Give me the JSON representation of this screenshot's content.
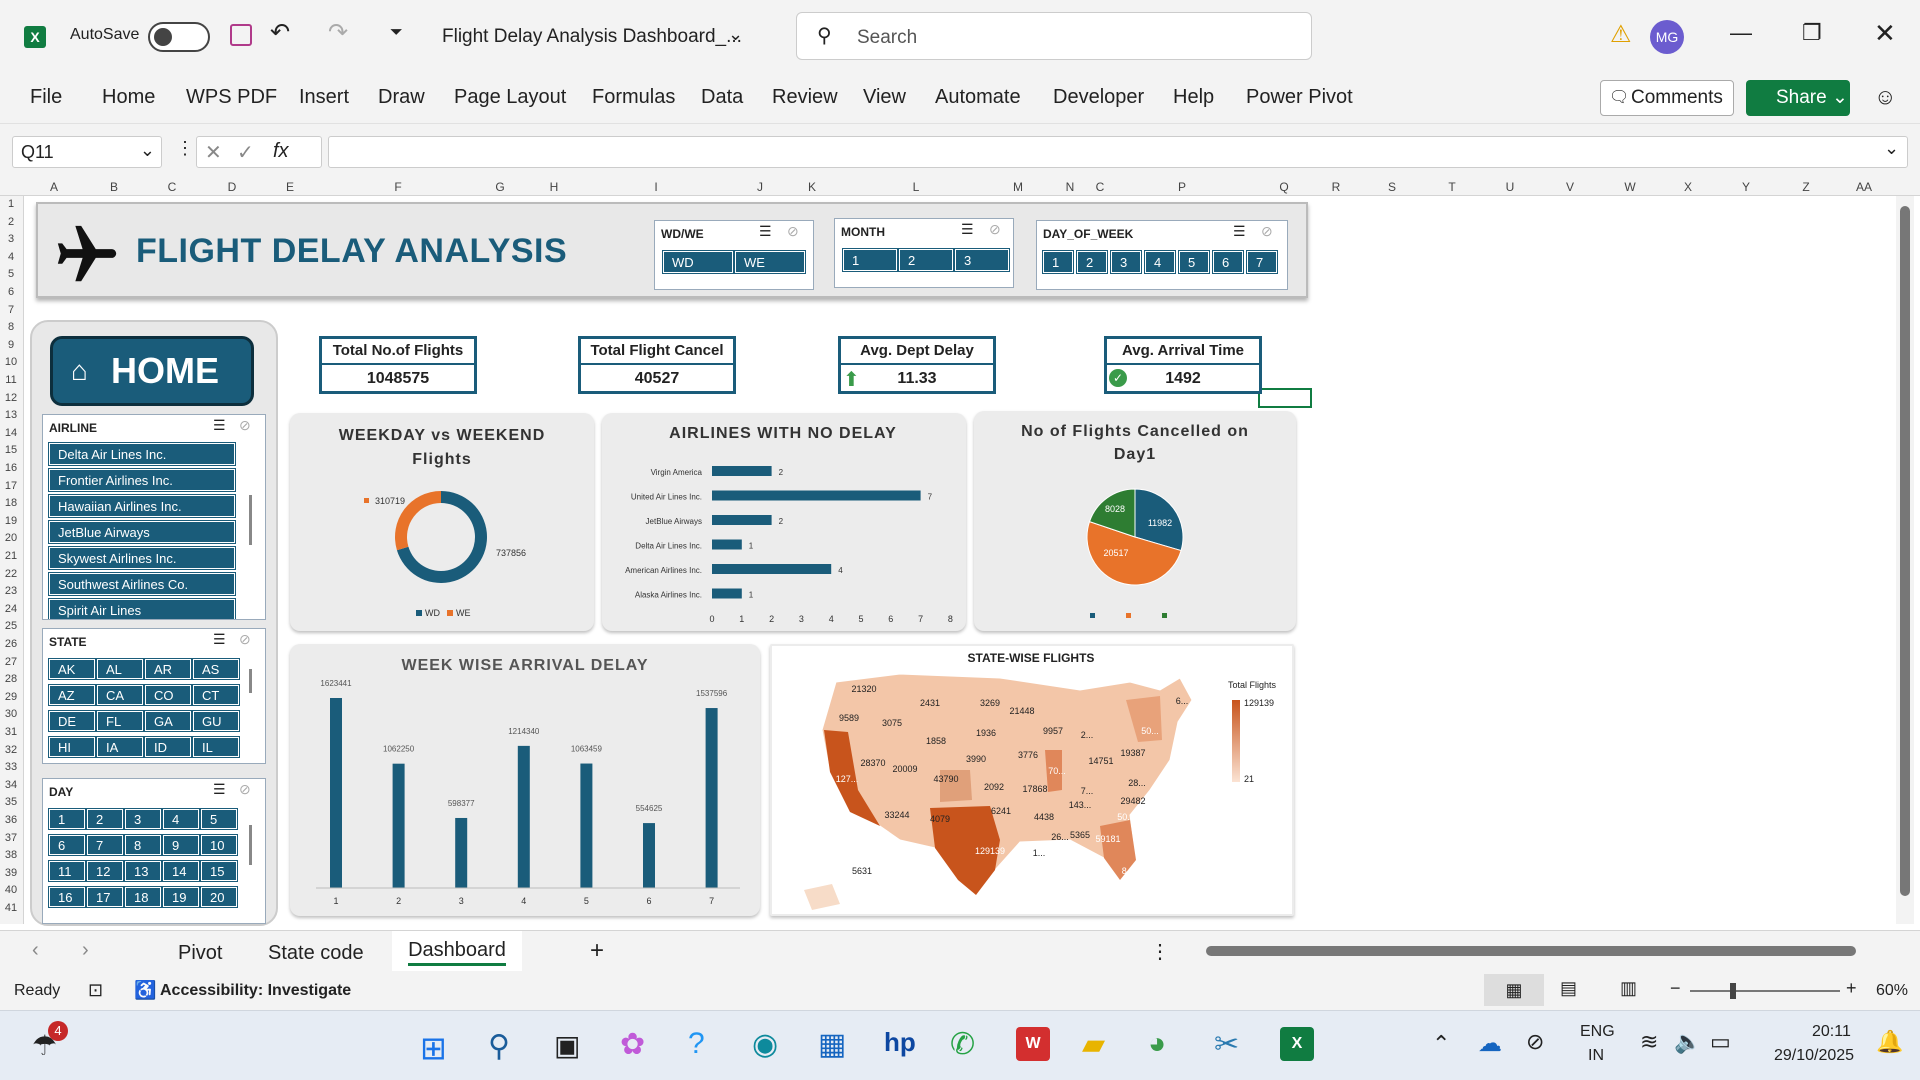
{
  "window": {
    "app_icon": "excel-icon",
    "autosave_label": "AutoSave",
    "autosave_state": "Off",
    "filename": "Flight Delay Analysis Dashboard_...",
    "search_placeholder": "Search",
    "user_initials": "MG"
  },
  "ribbon": {
    "tabs": [
      "File",
      "Home",
      "WPS PDF",
      "Insert",
      "Draw",
      "Page Layout",
      "Formulas",
      "Data",
      "Review",
      "View",
      "Automate",
      "Developer",
      "Help",
      "Power Pivot"
    ],
    "comments": "Comments",
    "share": "Share"
  },
  "formula": {
    "namebox": "Q11",
    "fx": "fx",
    "value": ""
  },
  "columns": [
    "A",
    "B",
    "C",
    "D",
    "E",
    "F",
    "G",
    "H",
    "I",
    "J",
    "K",
    "L",
    "M",
    "N",
    "C",
    "P",
    "Q",
    "R",
    "S",
    "T",
    "U",
    "V",
    "W",
    "X",
    "Y",
    "Z",
    "AA"
  ],
  "rows": [
    "1",
    "2",
    "3",
    "4",
    "5",
    "6",
    "7",
    "8",
    "9",
    "10",
    "11",
    "12",
    "13",
    "14",
    "15",
    "16",
    "17",
    "18",
    "19",
    "20",
    "21",
    "22",
    "23",
    "24",
    "25",
    "26",
    "27",
    "28",
    "29",
    "30",
    "31",
    "32",
    "33",
    "34",
    "35",
    "36",
    "37",
    "38",
    "39",
    "40",
    "41"
  ],
  "dashboard": {
    "title": "FLIGHT DELAY ANALYSIS",
    "home": "HOME",
    "slicers": {
      "wdwe": {
        "title": "WD/WE",
        "items": [
          "WD",
          "WE"
        ]
      },
      "month": {
        "title": "MONTH",
        "items": [
          "1",
          "2",
          "3"
        ]
      },
      "dow": {
        "title": "DAY_OF_WEEK",
        "items": [
          "1",
          "2",
          "3",
          "4",
          "5",
          "6",
          "7"
        ]
      },
      "airline": {
        "title": "AIRLINE",
        "items": [
          "Delta Air Lines Inc.",
          "Frontier Airlines Inc.",
          "Hawaiian Airlines Inc.",
          "JetBlue Airways",
          "Skywest Airlines Inc.",
          "Southwest Airlines Co.",
          "Spirit Air Lines"
        ]
      },
      "state": {
        "title": "STATE",
        "items": [
          "AK",
          "AL",
          "AR",
          "AS",
          "AZ",
          "CA",
          "CO",
          "CT",
          "DE",
          "FL",
          "GA",
          "GU",
          "HI",
          "IA",
          "ID",
          "IL"
        ]
      },
      "day": {
        "title": "DAY",
        "items": [
          "1",
          "2",
          "3",
          "4",
          "5",
          "6",
          "7",
          "8",
          "9",
          "10",
          "11",
          "12",
          "13",
          "14",
          "15",
          "16",
          "17",
          "18",
          "19",
          "20"
        ]
      }
    },
    "kpis": [
      {
        "label": "Total No.of Flights",
        "value": "1048575"
      },
      {
        "label": "Total Flight Cancel",
        "value": "40527"
      },
      {
        "label": "Avg. Dept Delay",
        "value": "11.33"
      },
      {
        "label": "Avg. Arrival Time",
        "value": "1492"
      }
    ]
  },
  "chart_data": [
    {
      "type": "pie",
      "variant": "donut",
      "title": "WEEKDAY vs WEEKEND Flights",
      "categories": [
        "WD",
        "WE"
      ],
      "values": [
        737856,
        310719
      ],
      "colors": [
        "#1a5c7a",
        "#e8732a"
      ],
      "legend": "bottom"
    },
    {
      "type": "bar",
      "orientation": "horizontal",
      "title": "AIRLINES WITH NO DELAY",
      "categories": [
        "Virgin America",
        "United Air Lines Inc.",
        "JetBlue Airways",
        "Delta Air Lines Inc.",
        "American Airlines Inc.",
        "Alaska Airlines Inc."
      ],
      "values": [
        2,
        7,
        2,
        1,
        4,
        1
      ],
      "xlim": [
        0,
        8
      ],
      "xticks": [
        "0",
        "1",
        "2",
        "3",
        "4",
        "5",
        "6",
        "7",
        "8"
      ]
    },
    {
      "type": "pie",
      "title": "No of Flights Cancelled on Day1",
      "values": [
        11982,
        20517,
        8028
      ],
      "value_labels": [
        "11982",
        "20517",
        "8028"
      ],
      "colors": [
        "#1a5c7a",
        "#e8732a",
        "#2e7d32"
      ],
      "legend": "bottom"
    },
    {
      "type": "bar",
      "title": "WEEK WISE ARRIVAL DELAY",
      "categories": [
        "1",
        "2",
        "3",
        "4",
        "5",
        "6",
        "7"
      ],
      "values": [
        1623441,
        1062250,
        598377,
        1214340,
        1063459,
        554625,
        1537596
      ]
    },
    {
      "type": "map",
      "title": "STATE-WISE FLIGHTS",
      "legend_title": "Total Flights",
      "range": [
        21,
        129139
      ],
      "range_labels": [
        "129139",
        "21"
      ],
      "labels": [
        "21320",
        "2431",
        "3269",
        "21448",
        "9589",
        "3075",
        "1858",
        "1936",
        "9957",
        "2...",
        "28370",
        "20009",
        "3990",
        "3776",
        "14751",
        "19387",
        "43790",
        "2092",
        "17868",
        "7...",
        "28...",
        "29482",
        "6241",
        "4438",
        "143...",
        "50...",
        "33244",
        "4079",
        "26...",
        "5365",
        "59181",
        "129139",
        "1...",
        "5631",
        "127...",
        "70...",
        "50...",
        "6...",
        "8..."
      ]
    }
  ],
  "sheets": {
    "tabs": [
      "Pivot",
      "State code",
      "Dashboard"
    ],
    "active": "Dashboard"
  },
  "status": {
    "ready": "Ready",
    "accessibility": "Accessibility: Investigate",
    "zoom": "60%"
  },
  "taskbar": {
    "badge": "4",
    "lang1": "ENG",
    "lang2": "IN",
    "time": "20:11",
    "date": "29/10/2025"
  }
}
